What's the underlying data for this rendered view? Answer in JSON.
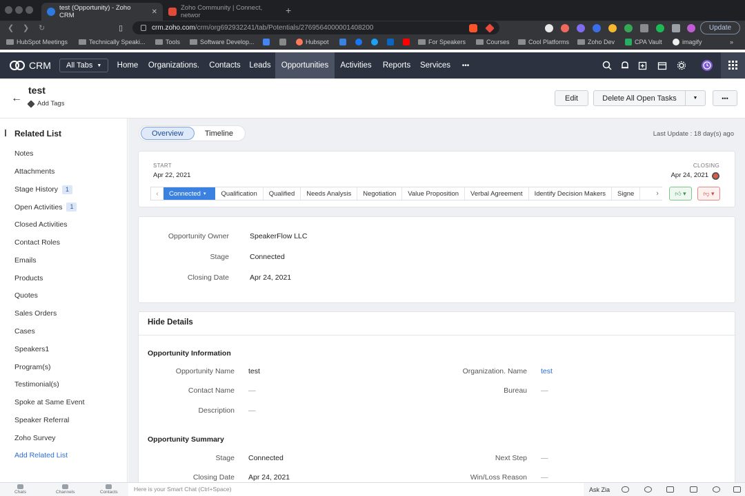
{
  "browser": {
    "tabs": [
      {
        "title": "test (Opportunity) - Zoho CRM",
        "active": true,
        "favicon": "zoho-crm-icon"
      },
      {
        "title": "Zoho Community | Connect, networ",
        "active": false,
        "favicon": "zoho-z-icon"
      }
    ],
    "url_host": "crm.zoho.com",
    "url_path": "/crm/org692932241/tab/Potentials/2769564000001408200",
    "update_label": "Update",
    "bookmarks": [
      "HubSpot Meetings",
      "Technically Speaki...",
      "Tools",
      "Software Develop...",
      "Hubspot",
      "For Speakers",
      "Courses",
      "Cool Platforms",
      "Zoho Dev",
      "CPA Vault",
      "imagify"
    ]
  },
  "crm_nav": {
    "logo_label": "CRM",
    "all_tabs_label": "All Tabs",
    "items": [
      "Home",
      "Organizations.",
      "Contacts",
      "Leads",
      "Opportunities",
      "Activities",
      "Reports",
      "Services"
    ],
    "active": "Opportunities",
    "more": "•••"
  },
  "record": {
    "title": "test",
    "add_tags": "Add Tags",
    "edit_label": "Edit",
    "delete_tasks_label": "Delete All Open Tasks",
    "more_label": "•••"
  },
  "sidebar": {
    "title": "Related List",
    "items": [
      {
        "label": "Notes",
        "badge": ""
      },
      {
        "label": "Attachments",
        "badge": ""
      },
      {
        "label": "Stage History",
        "badge": "1"
      },
      {
        "label": "Open Activities",
        "badge": "1"
      },
      {
        "label": "Closed Activities",
        "badge": ""
      },
      {
        "label": "Contact Roles",
        "badge": ""
      },
      {
        "label": "Emails",
        "badge": ""
      },
      {
        "label": "Products",
        "badge": ""
      },
      {
        "label": "Quotes",
        "badge": ""
      },
      {
        "label": "Sales Orders",
        "badge": ""
      },
      {
        "label": "Cases",
        "badge": ""
      },
      {
        "label": "Speakers1",
        "badge": ""
      },
      {
        "label": "Program(s)",
        "badge": ""
      },
      {
        "label": "Testimonial(s)",
        "badge": ""
      },
      {
        "label": "Spoke at Same Event",
        "badge": ""
      },
      {
        "label": "Speaker Referral",
        "badge": ""
      },
      {
        "label": "Zoho Survey",
        "badge": ""
      }
    ],
    "add_link": "Add Related List"
  },
  "view": {
    "tabs": [
      "Overview",
      "Timeline"
    ],
    "active_tab": "Overview",
    "last_update": "Last Update : 18 day(s) ago"
  },
  "stage_bar": {
    "start_label": "START",
    "start_date": "Apr 22, 2021",
    "closing_label": "CLOSING",
    "closing_date": "Apr 24, 2021",
    "stages": [
      "Connected",
      "Qualification",
      "Qualified",
      "Needs Analysis",
      "Negotiation",
      "Value Proposition",
      "Verbal Agreement",
      "Identify Decision Makers",
      "Signe"
    ],
    "current": "Connected"
  },
  "summary": {
    "rows": [
      {
        "key": "Opportunity Owner",
        "value": "SpeakerFlow LLC"
      },
      {
        "key": "Stage",
        "value": "Connected"
      },
      {
        "key": "Closing Date",
        "value": "Apr 24, 2021"
      }
    ]
  },
  "details": {
    "toggle_label": "Hide Details",
    "info_title": "Opportunity Information",
    "info_left": [
      {
        "key": "Opportunity Name",
        "value": "test"
      },
      {
        "key": "Contact Name",
        "value": "—"
      },
      {
        "key": "Description",
        "value": "—"
      }
    ],
    "info_right": [
      {
        "key": "Organization. Name",
        "value": "test"
      },
      {
        "key": "Bureau",
        "value": "—"
      }
    ],
    "summary_title": "Opportunity Summary",
    "summary_left": [
      {
        "key": "Stage",
        "value": "Connected"
      },
      {
        "key": "Closing Date",
        "value": "Apr 24, 2021"
      }
    ],
    "summary_right": [
      {
        "key": "Next Step",
        "value": "—"
      },
      {
        "key": "Win/Loss Reason",
        "value": "—"
      }
    ]
  },
  "bottom_bar": {
    "items": [
      "Chats",
      "Channels",
      "Contacts"
    ],
    "smart_chat_placeholder": "Here is your Smart Chat (Ctrl+Space)",
    "ask_zia": "Ask Zia"
  },
  "colors": {
    "nav_bg": "#2c3240",
    "accent": "#3b82e0",
    "link": "#2a6dd3"
  }
}
